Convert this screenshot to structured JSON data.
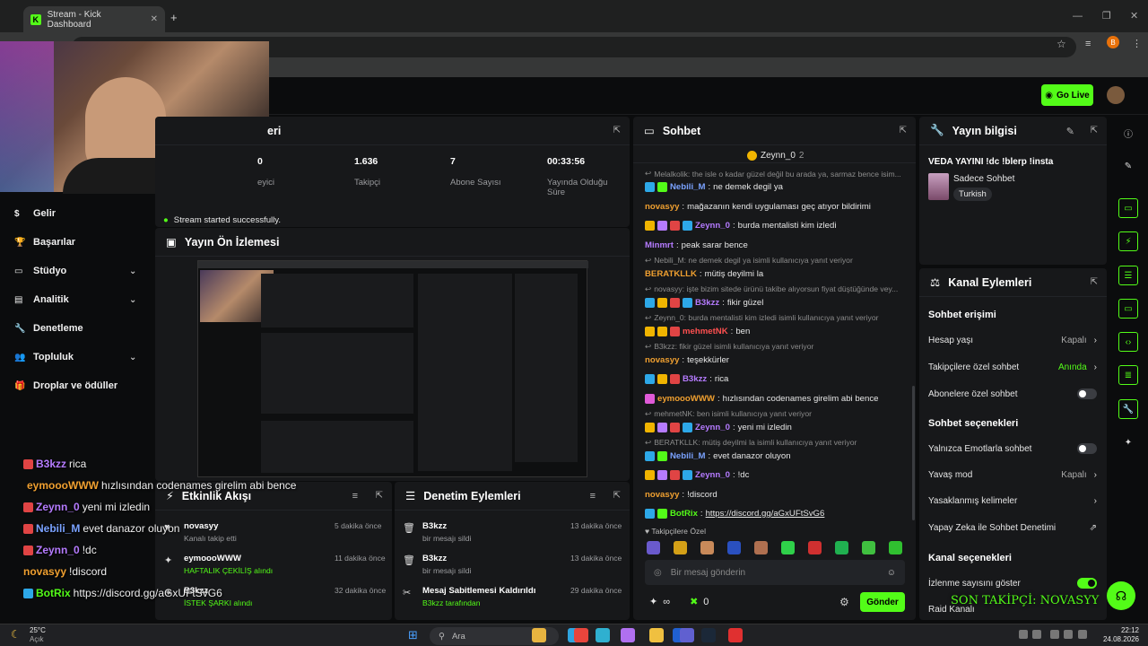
{
  "browser": {
    "tab_title": "Stream - Kick Dashboard",
    "url": "dashboard.kick.com/stream",
    "profile_initial": "B"
  },
  "header": {
    "go_live_label": "Go Live"
  },
  "sidebar": {
    "items": [
      {
        "label": "Gelir",
        "icon": "dollar-icon",
        "has_chevron": false
      },
      {
        "label": "Başarılar",
        "icon": "trophy-icon",
        "has_chevron": false
      },
      {
        "label": "Stüdyo",
        "icon": "studio-icon",
        "has_chevron": true
      },
      {
        "label": "Analitik",
        "icon": "chart-icon",
        "has_chevron": true
      },
      {
        "label": "Denetleme",
        "icon": "wrench-icon",
        "has_chevron": false
      },
      {
        "label": "Topluluk",
        "icon": "people-icon",
        "has_chevron": true
      },
      {
        "label": "Droplar ve ödüller",
        "icon": "gift-icon",
        "has_chevron": false
      }
    ]
  },
  "stats_panel": {
    "title_visible": "eri",
    "stats": [
      {
        "value": "0",
        "label": "eyici"
      },
      {
        "value": "1.636",
        "label": "Takipçi"
      },
      {
        "value": "7",
        "label": "Abone Sayısı"
      },
      {
        "value": "00:33:56",
        "label": "Yayında Olduğu Süre"
      }
    ],
    "status": "Stream started successfully."
  },
  "preview_panel": {
    "title": "Yayın Ön İzlemesi"
  },
  "activity_panel": {
    "title": "Etkinlik Akışı",
    "rows": [
      {
        "name": "novasyy",
        "sub": "Kanalı takip etti",
        "time": "5 dakika önce",
        "icon": "heart-icon"
      },
      {
        "name": "eymoooWWW",
        "sub": "HAFTALIK ÇEKİLİŞ alındı",
        "time": "11 dakika önce",
        "icon": "kick-points-icon"
      },
      {
        "name": "B3kzz",
        "sub": "İSTEK ŞARKI alındı",
        "time": "32 dakika önce",
        "icon": "kick-points-icon"
      }
    ]
  },
  "moderation_panel": {
    "title": "Denetim Eylemleri",
    "rows": [
      {
        "name": "B3kzz",
        "sub": "bir mesajı sildi",
        "time": "13 dakika önce",
        "icon": "trash-icon"
      },
      {
        "name": "B3kzz",
        "sub": "bir mesajı sildi",
        "time": "13 dakika önce",
        "icon": "trash-icon"
      },
      {
        "name": "Mesaj Sabitlemesi Kaldırıldı",
        "sub": "B3kzz tarafından",
        "time": "29 dakika önce",
        "icon": "unpin-icon"
      }
    ]
  },
  "chat": {
    "title": "Sohbet",
    "pinned_user": "Zeynn_0",
    "pinned_count": "2",
    "messages": [
      {
        "type": "reply",
        "text": "Melalkolik: the isle o kadar güzel değil bu arada ya, sarmaz bence isim..."
      },
      {
        "user": "Nebili_M",
        "color": "#7aa2ff",
        "text": "ne demek degil ya",
        "badges": [
          "#2da8e8",
          "#53fc18"
        ]
      },
      {
        "user": "novasyy",
        "color": "#f0a030",
        "text": "mağazanın kendi uygulaması geç atıyor bildirimi",
        "badges": []
      },
      {
        "user": "Zeynn_0",
        "color": "#b57bff",
        "text": "burda mentalisti kim izledi",
        "badges": [
          "#f0b400",
          "#b57bff",
          "#e04444",
          "#2da8e8"
        ]
      },
      {
        "user": "Minmrt",
        "color": "#b57bff",
        "text": "peak sarar bence",
        "badges": []
      },
      {
        "type": "reply",
        "text": "Nebili_M: ne demek degil ya isimli kullanıcıya yanıt veriyor"
      },
      {
        "user": "BERATKLLK",
        "color": "#f0a030",
        "text": "mütiş deyilmi la",
        "badges": []
      },
      {
        "type": "reply",
        "text": "novasyy: işte bizim sitede ürünü takibe alıyorsun fiyat düştüğünde vey..."
      },
      {
        "user": "B3kzz",
        "color": "#b57bff",
        "text": "fikir güzel",
        "badges": [
          "#2da8e8",
          "#f0b400",
          "#e04444",
          "#2da8e8"
        ]
      },
      {
        "type": "reply",
        "text": "Zeynn_0: burda mentalisti kim izledi isimli kullanıcıya yanıt veriyor"
      },
      {
        "user": "mehmetNK",
        "color": "#ff5050",
        "text": "ben",
        "badges": [
          "#f0b400",
          "#f0b400",
          "#e04444"
        ]
      },
      {
        "type": "reply",
        "text": "B3kzz: fikir güzel isimli kullanıcıya yanıt veriyor"
      },
      {
        "user": "novasyy",
        "color": "#f0a030",
        "text": "teşekkürler",
        "badges": []
      },
      {
        "user": "B3kzz",
        "color": "#b57bff",
        "text": "rica",
        "badges": [
          "#2da8e8",
          "#f0b400",
          "#e04444"
        ]
      },
      {
        "user": "eymoooWWW",
        "color": "#f0a030",
        "text": "hızlısından codenames girelim abi bence",
        "badges": [
          "#e05ad8"
        ]
      },
      {
        "type": "reply",
        "text": "mehmetNK: ben isimli kullanıcıya yanıt veriyor"
      },
      {
        "user": "Zeynn_0",
        "color": "#b57bff",
        "text": "yeni mi izledin",
        "badges": [
          "#f0b400",
          "#b57bff",
          "#e04444",
          "#2da8e8"
        ]
      },
      {
        "type": "reply",
        "text": "BERATKLLK: mütiş deyilmi la isimli kullanıcıya yanıt veriyor"
      },
      {
        "user": "Nebili_M",
        "color": "#7aa2ff",
        "text": "evet danazor oluyon",
        "badges": [
          "#2da8e8",
          "#53fc18"
        ]
      },
      {
        "user": "Zeynn_0",
        "color": "#b57bff",
        "text": "!dc",
        "badges": [
          "#f0b400",
          "#b57bff",
          "#e04444",
          "#2da8e8"
        ]
      },
      {
        "user": "novasyy",
        "color": "#f0a030",
        "text": "!discord",
        "badges": []
      },
      {
        "user": "BotRix",
        "color": "#53fc18",
        "text": "https://discord.gg/aGxUFtSvG6",
        "badges": [
          "#2da8e8",
          "#53fc18"
        ],
        "link": true
      }
    ],
    "follower_label": "Takipçilere Özel",
    "input_placeholder": "Bir mesaj gönderin",
    "send_label": "Gönder",
    "points_label": "∞",
    "count_label": "0"
  },
  "stream_info": {
    "title": "Yayın bilgisi",
    "stream_title": "VEDA YAYINI !dc !blerp !insta",
    "category": "Sadece Sohbet",
    "language": "Turkish"
  },
  "channel_actions": {
    "title": "Kanal Eylemleri",
    "chat_access_heading": "Sohbet erişimi",
    "rows_access": [
      {
        "label": "Hesap yaşı",
        "value": "Kapalı",
        "kind": "chevron"
      },
      {
        "label": "Takipçilere özel sohbet",
        "value": "Anında",
        "kind": "chevron",
        "value_color": "#53fc18"
      },
      {
        "label": "Abonelere özel sohbet",
        "value": "",
        "kind": "toggle",
        "on": false
      }
    ],
    "chat_options_heading": "Sohbet seçenekleri",
    "rows_options": [
      {
        "label": "Yalnızca Emotlarla sohbet",
        "value": "",
        "kind": "toggle",
        "on": false
      },
      {
        "label": "Yavaş mod",
        "value": "Kapalı",
        "kind": "chevron"
      },
      {
        "label": "Yasaklanmış kelimeler",
        "value": "",
        "kind": "chevron"
      },
      {
        "label": "Yapay Zeka ile Sohbet Denetimi",
        "value": "",
        "kind": "external"
      }
    ],
    "channel_options_heading": "Kanal seçenekleri",
    "rows_channel": [
      {
        "label": "İzlenme sayısını göster",
        "value": "",
        "kind": "toggle",
        "on": true
      },
      {
        "label": "Raid Kanalı",
        "value": "",
        "kind": "none"
      }
    ]
  },
  "overlay": {
    "last_follower": "SON TAKİPÇİ: NOVASYY",
    "chat": [
      {
        "user": "B3kzz",
        "color": "#b57bff",
        "text": "rica"
      },
      {
        "user": "eymoooWWW",
        "color": "#f0a030",
        "text": "hızlısından codenames girelim abi bence"
      },
      {
        "user": "Zeynn_0",
        "color": "#b57bff",
        "text": "yeni mi izledin"
      },
      {
        "user": "Nebili_M",
        "color": "#7aa2ff",
        "text": "evet danazor oluyon"
      },
      {
        "user": "Zeynn_0",
        "color": "#b57bff",
        "text": "!dc"
      },
      {
        "user": "novasyy",
        "color": "#f0a030",
        "text": "!discord"
      },
      {
        "user": "BotRix",
        "color": "#53fc18",
        "text": "https://discord.gg/aGxUFtSvG6"
      }
    ]
  },
  "taskbar": {
    "weather_temp": "25°C",
    "weather_desc": "Açık",
    "search_label": "Ara",
    "time": "22:12",
    "date": "24.08.2026"
  },
  "colors": {
    "accent": "#53fc18",
    "panel": "#17181a",
    "bg": "#0b0c0d"
  }
}
